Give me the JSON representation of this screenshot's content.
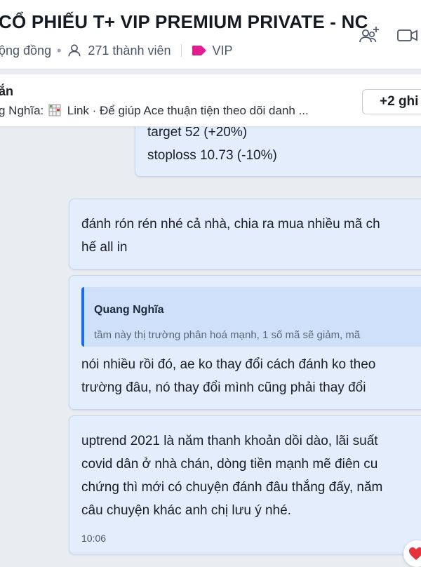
{
  "header": {
    "title": "CỔ PHIẾU T+ VIP PREMIUM PRIVATE - NC",
    "community_label": "ộng đồng",
    "members": "271 thành viên",
    "tag": "VIP",
    "icons": [
      "add-member-icon",
      "video-call-icon"
    ]
  },
  "pinned": {
    "title": "ắn",
    "author": "g Nghĩa:",
    "text": "Link · Để giúp Ace thuận tiện theo dõi danh ...",
    "more_button": "+2 ghi"
  },
  "messages": [
    {
      "lines": [
        "target 52 (+20%)",
        "stoploss 10.73 (-10%)"
      ]
    },
    {
      "lines": [
        "đánh rón rén nhé cả nhà, chia ra mua nhiều mã ch",
        "hế all in"
      ]
    },
    {
      "quote": {
        "name": "Quang Nghĩa",
        "text": "tầm này thị trường phân hoá mạnh, 1 số mã sẽ giảm, mã"
      },
      "lines": [
        "nói nhiều rồi đó, ae ko thay đổi cách đánh ko theo",
        "trường đâu, nó thay đổi mình cũng phải thay đổi"
      ]
    },
    {
      "lines": [
        "uptrend 2021 là năm thanh khoản dồi dào, lãi suất",
        "covid dân ở nhà chán, dòng tiền mạnh mẽ điên cu",
        "chứng thì mới có chuyện đánh đâu thắng đấy, năm",
        "câu chuyện khác anh chị lưu ý nhé."
      ],
      "time": "10:06"
    }
  ],
  "colors": {
    "accent": "#1a6bf0",
    "bubble": "#e3edfc",
    "tag": "#e11d8f",
    "reaction": "#e5323b"
  }
}
